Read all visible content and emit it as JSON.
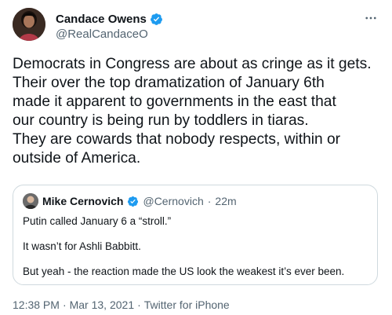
{
  "author": {
    "name": "Candace Owens",
    "handle": "@RealCandaceO",
    "verified_icon": "verified-badge-icon",
    "avatar_icon": "profile-photo-avatar"
  },
  "more_icon": "more-options-icon",
  "tweet_lines": [
    "Democrats in Congress are about as cringe as it gets.",
    "Their over the top dramatization of January 6th",
    "made it apparent to governments in the east that",
    "our country is being run by toddlers in tiaras.",
    "They are cowards that nobody respects, within or",
    "outside of America."
  ],
  "quoted_tweet": {
    "name": "Mike Cernovich",
    "handle": "@Cernovich",
    "separator": "·",
    "time": "22m",
    "lines": [
      "Putin called January 6 a “stroll.”",
      "It wasn’t for Ashli Babbitt.",
      "But yeah - the reaction made the US look the weakest it’s ever been."
    ]
  },
  "meta": {
    "time": "12:38 PM",
    "separator": "·",
    "date": "Mar 13, 2021",
    "source": "Twitter for iPhone"
  },
  "colors": {
    "text": "#0f1419",
    "secondary": "#536471",
    "verified": "#1d9bf0",
    "border": "#cfd9de"
  }
}
